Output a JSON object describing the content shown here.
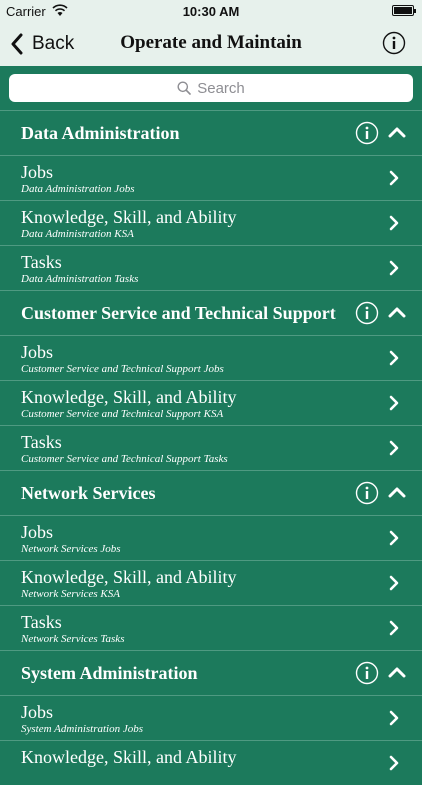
{
  "status": {
    "carrier": "Carrier",
    "time": "10:30 AM"
  },
  "nav": {
    "back_label": "Back",
    "title": "Operate and Maintain"
  },
  "search": {
    "placeholder": "Search"
  },
  "sections": [
    {
      "title": "Data Administration",
      "rows": [
        {
          "title": "Jobs",
          "subtitle": "Data Administration  Jobs"
        },
        {
          "title": "Knowledge, Skill, and Ability",
          "subtitle": "Data Administration  KSA"
        },
        {
          "title": "Tasks",
          "subtitle": "Data Administration  Tasks"
        }
      ]
    },
    {
      "title": "Customer Service and Technical Support",
      "rows": [
        {
          "title": "Jobs",
          "subtitle": "Customer Service and Technical Support Jobs"
        },
        {
          "title": "Knowledge, Skill, and Ability",
          "subtitle": "Customer Service and Technical Support KSA"
        },
        {
          "title": "Tasks",
          "subtitle": "Customer Service and Technical Support Tasks"
        }
      ]
    },
    {
      "title": "Network Services",
      "rows": [
        {
          "title": "Jobs",
          "subtitle": "Network Services Jobs"
        },
        {
          "title": "Knowledge, Skill, and Ability",
          "subtitle": "Network Services KSA"
        },
        {
          "title": "Tasks",
          "subtitle": "Network Services Tasks"
        }
      ]
    },
    {
      "title": "System Administration",
      "rows": [
        {
          "title": "Jobs",
          "subtitle": "System Administration  Jobs"
        },
        {
          "title": "Knowledge, Skill, and Ability",
          "subtitle": ""
        }
      ]
    }
  ],
  "colors": {
    "background": "#1c7a5c",
    "bar": "#e7f1ec",
    "separator": "#4f9a82"
  }
}
